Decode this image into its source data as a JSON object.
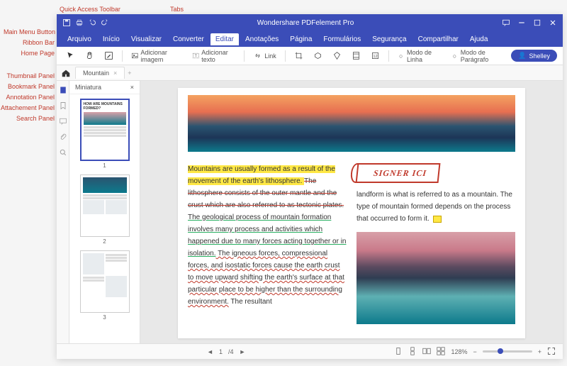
{
  "annotations": {
    "qat": "Quick Access Toolbar",
    "tabs": "Tabs",
    "mainmenu": "Main Menu Button",
    "ribbon": "Ribbon Bar",
    "home": "Home Page",
    "thumbnail": "Thumbnail Panel",
    "bookmark": "Bookmark Panel",
    "annotation": "Annotation Panel",
    "attachment": "Attachement Panel",
    "search": "Search Panel"
  },
  "titlebar": {
    "title": "Wondershare PDFelement Pro"
  },
  "menu": {
    "items": [
      "Arquivo",
      "Início",
      "Visualizar",
      "Converter",
      "Editar",
      "Anotações",
      "Página",
      "Formulários",
      "Segurança",
      "Compartilhar",
      "Ajuda"
    ],
    "active": "Editar"
  },
  "ribbon": {
    "add_image": "Adicionar imagem",
    "add_text": "Adicionar texto",
    "link": "Link",
    "mode_line": "Modo de Linha",
    "mode_paragraph": "Modo de Parágrafo"
  },
  "user": {
    "name": "Shelley"
  },
  "doc_tab": {
    "name": "Mountain"
  },
  "thumbs": {
    "header": "Miniatura",
    "pages": [
      "1",
      "2",
      "3"
    ]
  },
  "content": {
    "p1a": "Mountains are usually formed as a result of the movement of the earth's lithosphere. ",
    "p1b": "The lithosphere consists of the outer mantle and the crust which are also referred to as tectonic plates.",
    "p1c": " The geological process of mountain formation involves many process and activities which happened due to many forces acting together or in isolation.",
    "p1d": " The igneous forces, compressional forces, and isostatic forces cause the earth crust to move upward shifting the earth's surface at that particular place to be higher than the surrounding environment.",
    "p1e": " The resultant",
    "stamp": "SIGNER ICI",
    "p2a": "landform is what is referred to as a mountain. The type of mountain formed depends on the process that occurred to form it. "
  },
  "status": {
    "page_cur": "1",
    "page_total": "/4",
    "zoom": "128%"
  }
}
